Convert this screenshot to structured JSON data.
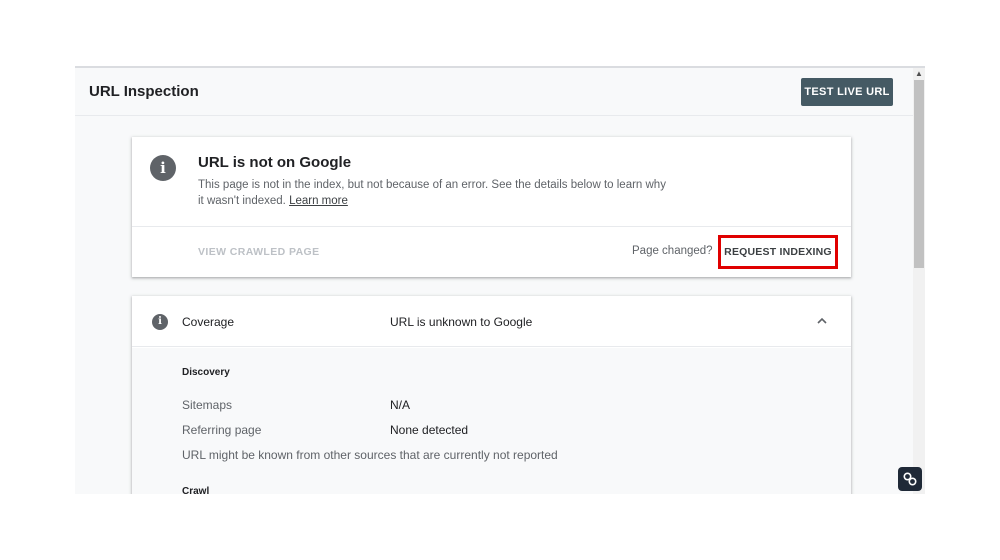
{
  "header": {
    "title": "URL Inspection",
    "test_live_label": "TEST LIVE URL",
    "accent_color": "#455a64"
  },
  "status": {
    "icon": "info-icon",
    "title": "URL is not on Google",
    "description": "This page is not in the index, but not because of an error. See the details below to learn why it wasn't indexed.",
    "learn_more_label": "Learn more",
    "view_crawled_label": "VIEW CRAWLED PAGE",
    "page_changed_label": "Page changed?",
    "request_indexing_label": "REQUEST INDEXING",
    "highlight_color": "#e00000"
  },
  "coverage": {
    "icon": "info-icon",
    "label": "Coverage",
    "value": "URL is unknown to Google",
    "expanded": true,
    "discovery": {
      "heading": "Discovery",
      "rows": [
        {
          "label": "Sitemaps",
          "value": "N/A"
        },
        {
          "label": "Referring page",
          "value": "None detected"
        }
      ],
      "note": "URL might be known from other sources that are currently not reported"
    },
    "crawl": {
      "heading": "Crawl"
    }
  },
  "overlay": {
    "icon": "link-icon"
  }
}
